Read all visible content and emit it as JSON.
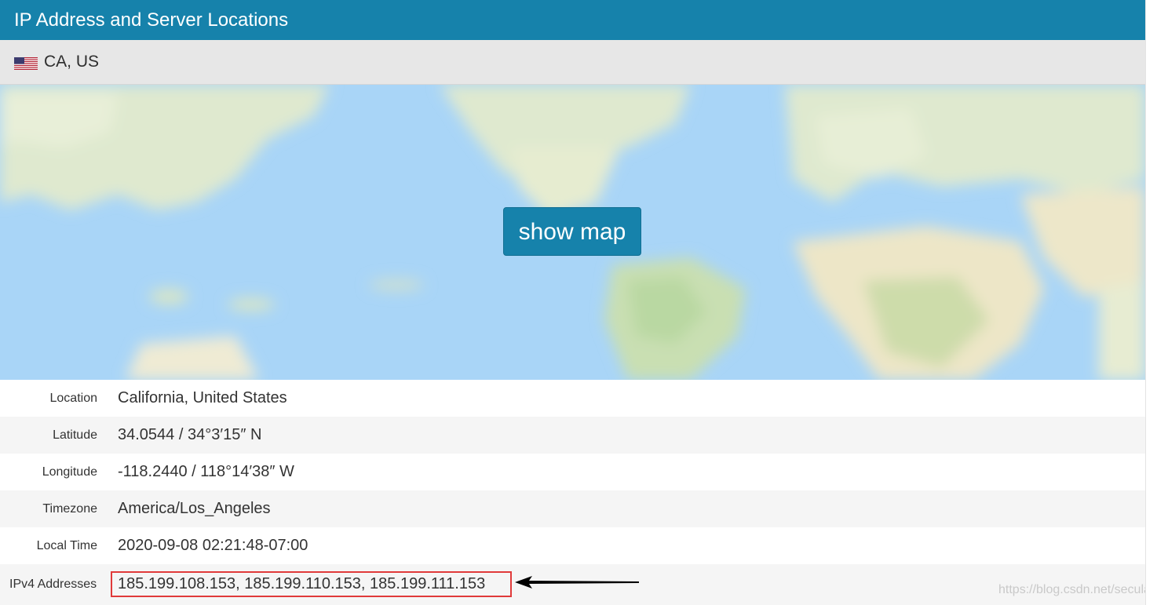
{
  "header": {
    "title": "IP Address and Server Locations"
  },
  "location_bar": {
    "flag_icon": "us-flag-icon",
    "text": "CA, US"
  },
  "map": {
    "button_label": "show map"
  },
  "details": [
    {
      "label": "Location",
      "value": "California, United States"
    },
    {
      "label": "Latitude",
      "value": "34.0544 / 34°3′15″ N"
    },
    {
      "label": "Longitude",
      "value": "-118.2440 / 118°14′38″ W"
    },
    {
      "label": "Timezone",
      "value": "America/Los_Angeles"
    },
    {
      "label": "Local Time",
      "value": "2020-09-08 02:21:48-07:00"
    }
  ],
  "ipv4": {
    "label": "IPv4 Addresses",
    "value": "185.199.108.153, 185.199.110.153, 185.199.111.153"
  },
  "annotation": {
    "arrow_icon": "left-arrow-icon",
    "highlight_color": "#e03a3a"
  },
  "watermark": "https://blog.csdn.net/secular_",
  "colors": {
    "header": "#1682ab",
    "button": "#1682ab"
  }
}
